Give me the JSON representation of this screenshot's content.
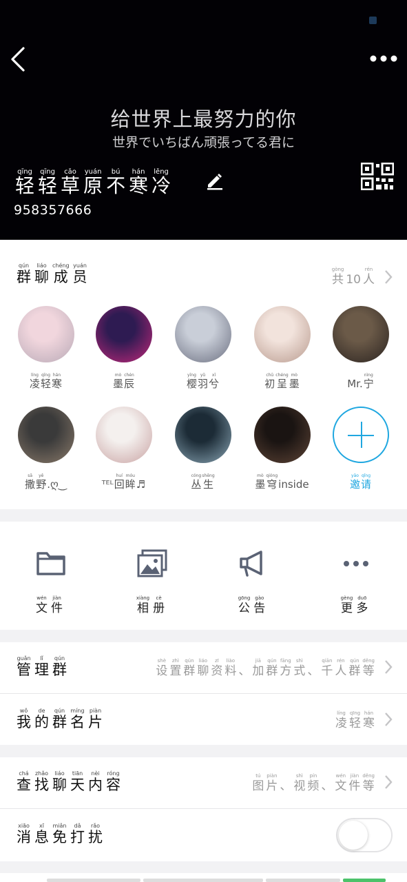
{
  "header": {
    "slogan_cn": "给世界上最努力的你",
    "slogan_jp": "世界でいちばん頑張ってる君に",
    "group_name": [
      {
        "py": "qīng",
        "hz": "轻"
      },
      {
        "py": "qīng",
        "hz": "轻"
      },
      {
        "py": "cǎo",
        "hz": "草"
      },
      {
        "py": "yuán",
        "hz": "原"
      },
      {
        "py": "bú",
        "hz": "不"
      },
      {
        "py": "hán",
        "hz": "寒"
      },
      {
        "py": "lěng",
        "hz": "冷"
      }
    ],
    "group_id": "958357666",
    "icons": {
      "back": "back-chevron-icon",
      "more": "more-dots-icon",
      "edit": "pencil-icon",
      "qr": "qr-code-icon"
    }
  },
  "members": {
    "title": [
      {
        "py": "qún",
        "hz": "群"
      },
      {
        "py": "liáo",
        "hz": "聊"
      },
      {
        "py": "chéng",
        "hz": "成"
      },
      {
        "py": "yuán",
        "hz": "员"
      }
    ],
    "count_label": [
      {
        "py": "gòng",
        "hz": "共"
      },
      {
        "py": "",
        "hz": "10"
      },
      {
        "py": "rén",
        "hz": "人"
      }
    ],
    "list": [
      {
        "name": [
          {
            "py": "líng",
            "hz": "凌"
          },
          {
            "py": "qīng",
            "hz": "轻"
          },
          {
            "py": "hán",
            "hz": "寒"
          }
        ],
        "color_a": "#f1d6dd",
        "color_b": "#b8a9b6"
      },
      {
        "name": [
          {
            "py": "mò",
            "hz": "墨"
          },
          {
            "py": "chén",
            "hz": "辰"
          }
        ],
        "color_a": "#2e1b52",
        "color_b": "#c3287a"
      },
      {
        "name": [
          {
            "py": "yīng",
            "hz": "樱"
          },
          {
            "py": "yǔ",
            "hz": "羽"
          },
          {
            "py": "xī",
            "hz": "兮"
          }
        ],
        "color_a": "#c9ced8",
        "color_b": "#6b6f80"
      },
      {
        "name": [
          {
            "py": "chū",
            "hz": "初"
          },
          {
            "py": "chéng",
            "hz": "呈"
          },
          {
            "py": "mò",
            "hz": "墨"
          }
        ],
        "color_a": "#f2e3dc",
        "color_b": "#b89a8e"
      },
      {
        "name": [
          {
            "py": "",
            "hz": "Mr."
          },
          {
            "py": "nìng",
            "hz": "宁"
          }
        ],
        "color_a": "#6b5a48",
        "color_b": "#2a2320"
      },
      {
        "name": [
          {
            "py": "sā",
            "hz": "撒"
          },
          {
            "py": "yě",
            "hz": "野"
          },
          {
            "py": "",
            "hz": ".ღ‿"
          }
        ],
        "color_a": "#3a3a3a",
        "color_b": "#8a7a6a"
      },
      {
        "name": [
          {
            "py": "",
            "hz": "ᵀᴱᴸ"
          },
          {
            "py": "huí",
            "hz": "回"
          },
          {
            "py": "móu",
            "hz": "眸"
          },
          {
            "py": "",
            "hz": "♬"
          }
        ],
        "color_a": "#f4f0ee",
        "color_b": "#c9a3a3"
      },
      {
        "name": [
          {
            "py": "cóng",
            "hz": "丛"
          },
          {
            "py": "shēng",
            "hz": "生"
          }
        ],
        "color_a": "#1c2b36",
        "color_b": "#8aa6b5"
      },
      {
        "name": [
          {
            "py": "mò",
            "hz": "墨"
          },
          {
            "py": "qióng",
            "hz": "穹"
          },
          {
            "py": "",
            "hz": "inside"
          }
        ],
        "color_a": "#1a1412",
        "color_b": "#5e4436"
      }
    ],
    "invite": [
      {
        "py": "yāo",
        "hz": "邀"
      },
      {
        "py": "qǐng",
        "hz": "请"
      }
    ],
    "invite_icon": "plus-icon"
  },
  "tools": [
    {
      "icon": "folder-icon",
      "label": [
        {
          "py": "wén",
          "hz": "文"
        },
        {
          "py": "jiàn",
          "hz": "件"
        }
      ]
    },
    {
      "icon": "album-icon",
      "label": [
        {
          "py": "xiàng",
          "hz": "相"
        },
        {
          "py": "cè",
          "hz": "册"
        }
      ]
    },
    {
      "icon": "megaphone-icon",
      "label": [
        {
          "py": "gōng",
          "hz": "公"
        },
        {
          "py": "gào",
          "hz": "告"
        }
      ]
    },
    {
      "icon": "more-dots-icon",
      "label": [
        {
          "py": "gèng",
          "hz": "更"
        },
        {
          "py": "duō",
          "hz": "多"
        }
      ]
    }
  ],
  "manage": {
    "title": [
      {
        "py": "guǎn",
        "hz": "管"
      },
      {
        "py": "lǐ",
        "hz": "理"
      },
      {
        "py": "qún",
        "hz": "群"
      }
    ],
    "detail": [
      {
        "py": "shè",
        "hz": "设"
      },
      {
        "py": "zhì",
        "hz": "置"
      },
      {
        "py": "qún",
        "hz": "群"
      },
      {
        "py": "liáo",
        "hz": "聊"
      },
      {
        "py": "zī",
        "hz": "资"
      },
      {
        "py": "liào",
        "hz": "料"
      },
      {
        "py": "",
        "hz": "、"
      },
      {
        "py": "jiā",
        "hz": "加"
      },
      {
        "py": "qún",
        "hz": "群"
      },
      {
        "py": "fāng",
        "hz": "方"
      },
      {
        "py": "shì",
        "hz": "式"
      },
      {
        "py": "",
        "hz": "、"
      },
      {
        "py": "qiān",
        "hz": "千"
      },
      {
        "py": "rén",
        "hz": "人"
      },
      {
        "py": "qún",
        "hz": "群"
      },
      {
        "py": "děng",
        "hz": "等"
      }
    ]
  },
  "card": {
    "title": [
      {
        "py": "wǒ",
        "hz": "我"
      },
      {
        "py": "de",
        "hz": "的"
      },
      {
        "py": "qún",
        "hz": "群"
      },
      {
        "py": "míng",
        "hz": "名"
      },
      {
        "py": "piàn",
        "hz": "片"
      }
    ],
    "detail": [
      {
        "py": "líng",
        "hz": "凌"
      },
      {
        "py": "qīng",
        "hz": "轻"
      },
      {
        "py": "hán",
        "hz": "寒"
      }
    ]
  },
  "search": {
    "title": [
      {
        "py": "chá",
        "hz": "查"
      },
      {
        "py": "zhǎo",
        "hz": "找"
      },
      {
        "py": "liáo",
        "hz": "聊"
      },
      {
        "py": "tiān",
        "hz": "天"
      },
      {
        "py": "nèi",
        "hz": "内"
      },
      {
        "py": "róng",
        "hz": "容"
      }
    ],
    "detail": [
      {
        "py": "tú",
        "hz": "图"
      },
      {
        "py": "piàn",
        "hz": "片"
      },
      {
        "py": "",
        "hz": "、"
      },
      {
        "py": "shì",
        "hz": "视"
      },
      {
        "py": "pín",
        "hz": "频"
      },
      {
        "py": "",
        "hz": "、"
      },
      {
        "py": "wén",
        "hz": "文"
      },
      {
        "py": "jiàn",
        "hz": "件"
      },
      {
        "py": "děng",
        "hz": "等"
      }
    ]
  },
  "dnd": {
    "title": [
      {
        "py": "xiāo",
        "hz": "消"
      },
      {
        "py": "xī",
        "hz": "息"
      },
      {
        "py": "miǎn",
        "hz": "免"
      },
      {
        "py": "dǎ",
        "hz": "打"
      },
      {
        "py": "rǎo",
        "hz": "扰"
      }
    ],
    "enabled": false
  },
  "colors": {
    "accent": "#1fa7e0",
    "header_bg": "#020105",
    "page_bg": "#f2f2f4",
    "icon_gray": "#5a6274"
  }
}
